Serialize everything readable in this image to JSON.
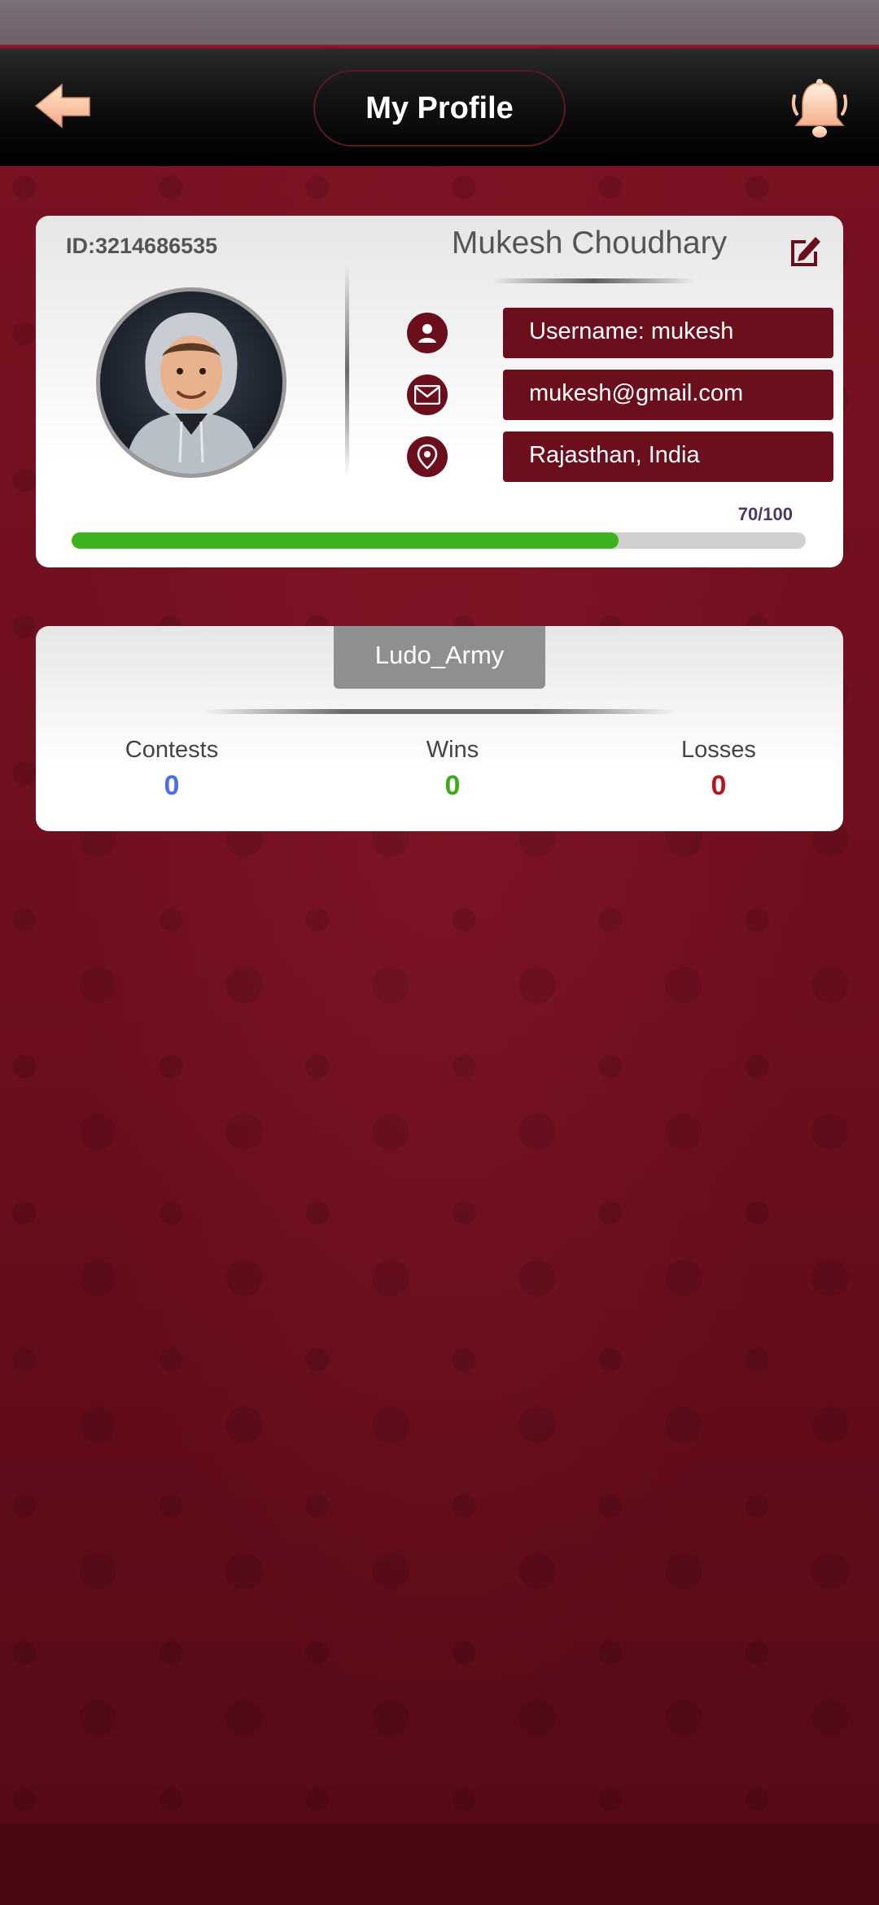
{
  "header": {
    "title": "My Profile",
    "back_icon": "back-arrow-icon",
    "bell_icon": "bell-icon"
  },
  "profile": {
    "id": "ID:3214686535",
    "name": "Mukesh Choudhary",
    "edit_icon": "edit-icon",
    "username": "Username: mukesh",
    "email": "mukesh@gmail.com",
    "location": "Rajasthan, India",
    "progress_text": "70/100",
    "progress_fraction": 0.745
  },
  "stats": {
    "group_name": "Ludo_Army",
    "contests_label": "Contests",
    "contests_value": "0",
    "wins_label": "Wins",
    "wins_value": "0",
    "losses_label": "Losses",
    "losses_value": "0"
  },
  "colors": {
    "brand_maroon": "#6b0f1d",
    "progress_green": "#3cb21f",
    "contests_blue": "#4a6cf0",
    "wins_green": "#3caa1c",
    "losses_red": "#b8141e",
    "accent_peach": "#ffd3a8"
  }
}
